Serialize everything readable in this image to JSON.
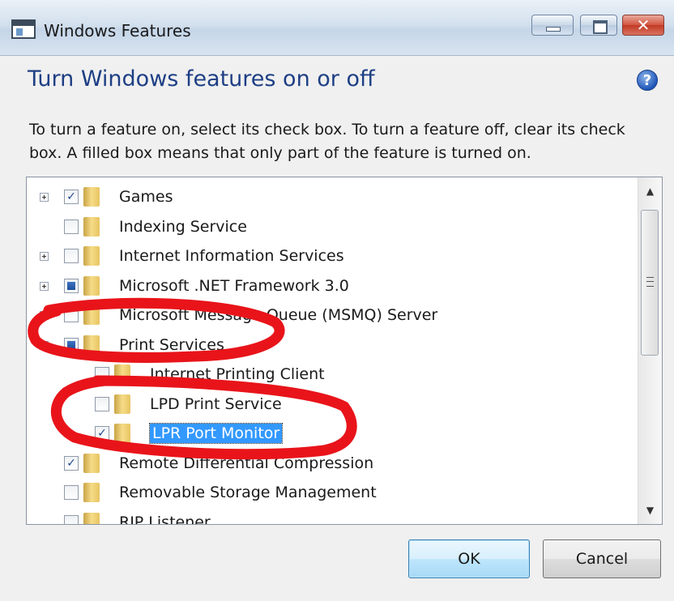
{
  "window": {
    "title": "Windows Features",
    "close_glyph": "✕"
  },
  "header": {
    "heading": "Turn Windows features on or off",
    "help_glyph": "?",
    "description": "To turn a feature on, select its check box. To turn a feature off, clear its check box. A filled box means that only part of the feature is turned on."
  },
  "features": [
    {
      "label": "Games",
      "state": "checked",
      "expander": "plus",
      "level": 0
    },
    {
      "label": "Indexing Service",
      "state": "unchecked",
      "expander": "none",
      "level": 0
    },
    {
      "label": "Internet Information Services",
      "state": "unchecked",
      "expander": "plus",
      "level": 0
    },
    {
      "label": "Microsoft .NET Framework 3.0",
      "state": "partial",
      "expander": "plus",
      "level": 0
    },
    {
      "label": "Microsoft Message Queue (MSMQ) Server",
      "state": "unchecked",
      "expander": "plus",
      "level": 0
    },
    {
      "label": "Print Services",
      "state": "partial",
      "expander": "minus",
      "level": 0
    },
    {
      "label": "Internet Printing Client",
      "state": "unchecked",
      "expander": "none",
      "level": 1
    },
    {
      "label": "LPD Print Service",
      "state": "unchecked",
      "expander": "none",
      "level": 1
    },
    {
      "label": "LPR Port Monitor",
      "state": "checked",
      "expander": "none",
      "level": 1,
      "selected": true
    },
    {
      "label": "Remote Differential Compression",
      "state": "checked",
      "expander": "none",
      "level": 0
    },
    {
      "label": "Removable Storage Management",
      "state": "unchecked",
      "expander": "none",
      "level": 0
    },
    {
      "label": "RIP Listener",
      "state": "unchecked",
      "expander": "none",
      "level": 0
    }
  ],
  "buttons": {
    "ok": "OK",
    "cancel": "Cancel"
  },
  "colors": {
    "heading": "#1e3f85",
    "selection": "#3399ff",
    "annotation": "#e8141a"
  }
}
